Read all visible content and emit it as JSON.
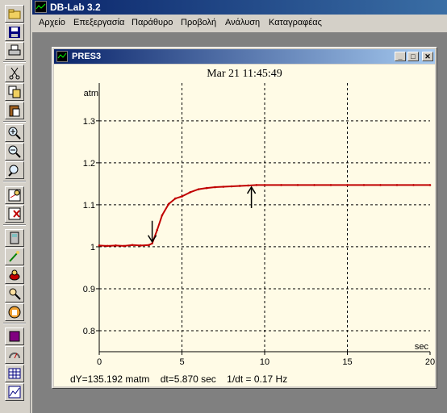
{
  "app": {
    "title": "DB-Lab 3.2"
  },
  "menu": [
    "Αρχείο",
    "Επεξεργασία",
    "Παράθυρο",
    "Προβολή",
    "Ανάλυση",
    "Καταγραφέας"
  ],
  "window": {
    "title": "PRES3",
    "timestamp": "Mar 21 11:45:49",
    "controls": {
      "minimize": "_",
      "maximize": "□",
      "close": "✕"
    }
  },
  "toolbar": {
    "buttons": [
      "open-folder-icon",
      "save-disk-icon",
      "print-icon",
      "cut-icon",
      "copy-icon",
      "paste-icon",
      "zoom-in-icon",
      "zoom-out-icon",
      "zoom-fit-icon",
      "add-marker-icon",
      "delete-marker-icon",
      "device-icon",
      "sensor-probe-icon",
      "record-icon",
      "inspect-icon",
      "hand-pan-icon",
      "stop-icon",
      "gauge-icon",
      "table-icon",
      "graph-icon"
    ]
  },
  "chart_data": {
    "type": "line",
    "ylabel": "atm",
    "xlabel": "sec",
    "xlim": [
      0,
      20
    ],
    "ylim": [
      0.75,
      1.39
    ],
    "xticks": [
      "0",
      "5",
      "10",
      "15",
      "20"
    ],
    "yticks": [
      "0.8",
      "0.9",
      "1",
      "1.1",
      "1.2",
      "1.3"
    ],
    "grid": true,
    "series": [
      {
        "color": "#c00000",
        "x": [
          0,
          0.5,
          1,
          1.5,
          2,
          2.5,
          3,
          3.2,
          3.5,
          3.8,
          4.2,
          4.6,
          5,
          5.5,
          6,
          6.5,
          7,
          7.5,
          8,
          8.5,
          9,
          9.5,
          10,
          11,
          12,
          13,
          14,
          15,
          16,
          17,
          18,
          19,
          20
        ],
        "y": [
          1.003,
          1.002,
          1.003,
          1.002,
          1.004,
          1.003,
          1.004,
          1.008,
          1.04,
          1.075,
          1.102,
          1.115,
          1.12,
          1.13,
          1.137,
          1.14,
          1.142,
          1.143,
          1.144,
          1.145,
          1.146,
          1.147,
          1.147,
          1.147,
          1.147,
          1.147,
          1.147,
          1.147,
          1.147,
          1.147,
          1.147,
          1.147,
          1.147
        ]
      }
    ],
    "markers": [
      {
        "x": 3.2,
        "y": 1.008,
        "direction": "down"
      },
      {
        "x": 9.2,
        "y": 1.146,
        "direction": "up"
      }
    ]
  },
  "readout": {
    "dy": "dY=135.192 matm",
    "dt": "dt=5.870 sec",
    "freq": "1/dt = 0.17 Hz"
  }
}
